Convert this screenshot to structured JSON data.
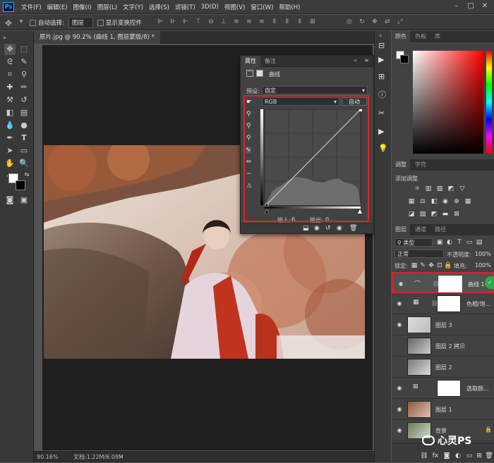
{
  "menubar": {
    "logo": "Ps",
    "items": [
      "文件(F)",
      "编辑(E)",
      "图像(I)",
      "图层(L)",
      "文字(Y)",
      "选择(S)",
      "滤镜(T)",
      "3D(D)",
      "视图(V)",
      "窗口(W)",
      "帮助(H)"
    ]
  },
  "options": {
    "auto_select_label": "自动选择:",
    "auto_select_value": "图层",
    "show_transform_label": "显示变换控件"
  },
  "document": {
    "tab_title": "原片.jpg @ 90.2% (曲线 1, 图层蒙版/8) *",
    "zoom": "90.16%",
    "doc_info": "文档:1.22M/6.09M"
  },
  "properties": {
    "tab_properties": "属性",
    "tab_notes": "备注",
    "adjustment_name": "曲线",
    "preset_label": "预设:",
    "preset_value": "自定",
    "channel_value": "RGB",
    "auto_button": "自动",
    "input_label": "输入:",
    "input_value": "6",
    "output_label": "输出:",
    "output_value": "0"
  },
  "color_panel": {
    "tabs": [
      "颜色",
      "色板",
      "库"
    ]
  },
  "adjustments_panel": {
    "tabs": [
      "调整",
      "字符"
    ],
    "add_label": "添加调整"
  },
  "layers_panel": {
    "tabs": [
      "图层",
      "通道",
      "路径"
    ],
    "filter_kind": "类型",
    "blend_mode": "正常",
    "opacity_label": "不透明度:",
    "opacity_value": "100%",
    "lock_label": "锁定:",
    "fill_label": "填充:",
    "fill_value": "100%",
    "layers": [
      {
        "name": "曲线 1",
        "selected": true
      },
      {
        "name": "色相/饱...",
        "selected": false
      },
      {
        "name": "图层 3",
        "selected": false
      },
      {
        "name": "图层 2 拷贝",
        "selected": false
      },
      {
        "name": "图层 2",
        "selected": false
      },
      {
        "name": "选取颜...",
        "selected": false
      },
      {
        "name": "图层 1",
        "selected": false
      },
      {
        "name": "背景",
        "selected": false
      }
    ]
  },
  "watermark": "心灵PS",
  "colors": {
    "highlight_red": "#d9242a",
    "panel_bg": "#424242",
    "app_bg": "#535353",
    "accent_blue": "#31a8ff"
  }
}
